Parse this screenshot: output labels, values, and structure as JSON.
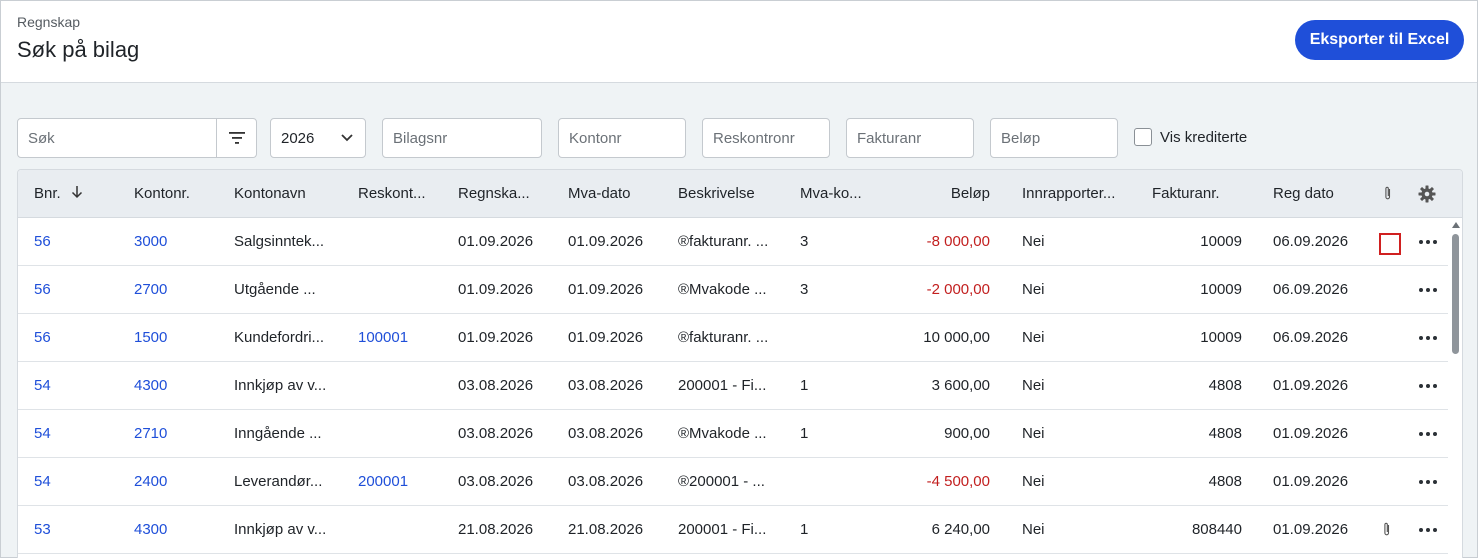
{
  "header": {
    "breadcrumb": "Regnskap",
    "title": "Søk på bilag",
    "export_label": "Eksporter til Excel"
  },
  "filters": {
    "search_placeholder": "Søk",
    "year_value": "2026",
    "bilagsnr_placeholder": "Bilagsnr",
    "kontonr_placeholder": "Kontonr",
    "reskontronr_placeholder": "Reskontronr",
    "fakturanr_placeholder": "Fakturanr",
    "belop_placeholder": "Beløp",
    "vis_krediterte_label": "Vis krediterte"
  },
  "table": {
    "columns": [
      "Bnr.",
      "Kontonr.",
      "Kontonavn",
      "Reskont...",
      "Regnska...",
      "Mva-dato",
      "Beskrivelse",
      "Mva-ko...",
      "Beløp",
      "Innrapporter...",
      "Fakturanr.",
      "Reg dato"
    ],
    "rows": [
      {
        "bnr": "56",
        "kontonr": "3000",
        "kontonavn": "Salgsinntek...",
        "reskontro": "",
        "regnskap": "01.09.2026",
        "mva_dato": "01.09.2026",
        "beskrivelse": "®fakturanr. ...",
        "mva_kode": "3",
        "belop": "-8 000,00",
        "negative": true,
        "innrapportert": "Nei",
        "fakturanr": "10009",
        "reg_dato": "06.09.2026",
        "attachment": false
      },
      {
        "bnr": "56",
        "kontonr": "2700",
        "kontonavn": "Utgående ...",
        "reskontro": "",
        "regnskap": "01.09.2026",
        "mva_dato": "01.09.2026",
        "beskrivelse": "®Mvakode ...",
        "mva_kode": "3",
        "belop": "-2 000,00",
        "negative": true,
        "innrapportert": "Nei",
        "fakturanr": "10009",
        "reg_dato": "06.09.2026",
        "attachment": false
      },
      {
        "bnr": "56",
        "kontonr": "1500",
        "kontonavn": "Kundefordri...",
        "reskontro": "100001",
        "regnskap": "01.09.2026",
        "mva_dato": "01.09.2026",
        "beskrivelse": "®fakturanr. ...",
        "mva_kode": "",
        "belop": "10 000,00",
        "negative": false,
        "innrapportert": "Nei",
        "fakturanr": "10009",
        "reg_dato": "06.09.2026",
        "attachment": false
      },
      {
        "bnr": "54",
        "kontonr": "4300",
        "kontonavn": "Innkjøp av v...",
        "reskontro": "",
        "regnskap": "03.08.2026",
        "mva_dato": "03.08.2026",
        "beskrivelse": "200001 - Fi...",
        "mva_kode": "1",
        "belop": "3 600,00",
        "negative": false,
        "innrapportert": "Nei",
        "fakturanr": "4808",
        "reg_dato": "01.09.2026",
        "attachment": false
      },
      {
        "bnr": "54",
        "kontonr": "2710",
        "kontonavn": "Inngående ...",
        "reskontro": "",
        "regnskap": "03.08.2026",
        "mva_dato": "03.08.2026",
        "beskrivelse": "®Mvakode ...",
        "mva_kode": "1",
        "belop": "900,00",
        "negative": false,
        "innrapportert": "Nei",
        "fakturanr": "4808",
        "reg_dato": "01.09.2026",
        "attachment": false
      },
      {
        "bnr": "54",
        "kontonr": "2400",
        "kontonavn": "Leverandør...",
        "reskontro": "200001",
        "regnskap": "03.08.2026",
        "mva_dato": "03.08.2026",
        "beskrivelse": "®200001 - ...",
        "mva_kode": "",
        "belop": "-4 500,00",
        "negative": true,
        "innrapportert": "Nei",
        "fakturanr": "4808",
        "reg_dato": "01.09.2026",
        "attachment": false
      },
      {
        "bnr": "53",
        "kontonr": "4300",
        "kontonavn": "Innkjøp av v...",
        "reskontro": "",
        "regnskap": "21.08.2026",
        "mva_dato": "21.08.2026",
        "beskrivelse": "200001 - Fi...",
        "mva_kode": "1",
        "belop": "6 240,00",
        "negative": false,
        "innrapportert": "Nei",
        "fakturanr": "808440",
        "reg_dato": "01.09.2026",
        "attachment": true
      }
    ]
  },
  "colors": {
    "accent": "#1f4fd9",
    "negative": "#c21f1f"
  },
  "icons": [
    "filter-icon",
    "chevron-down-icon",
    "sort-down-icon",
    "paperclip-icon",
    "gear-icon",
    "more-icon"
  ]
}
